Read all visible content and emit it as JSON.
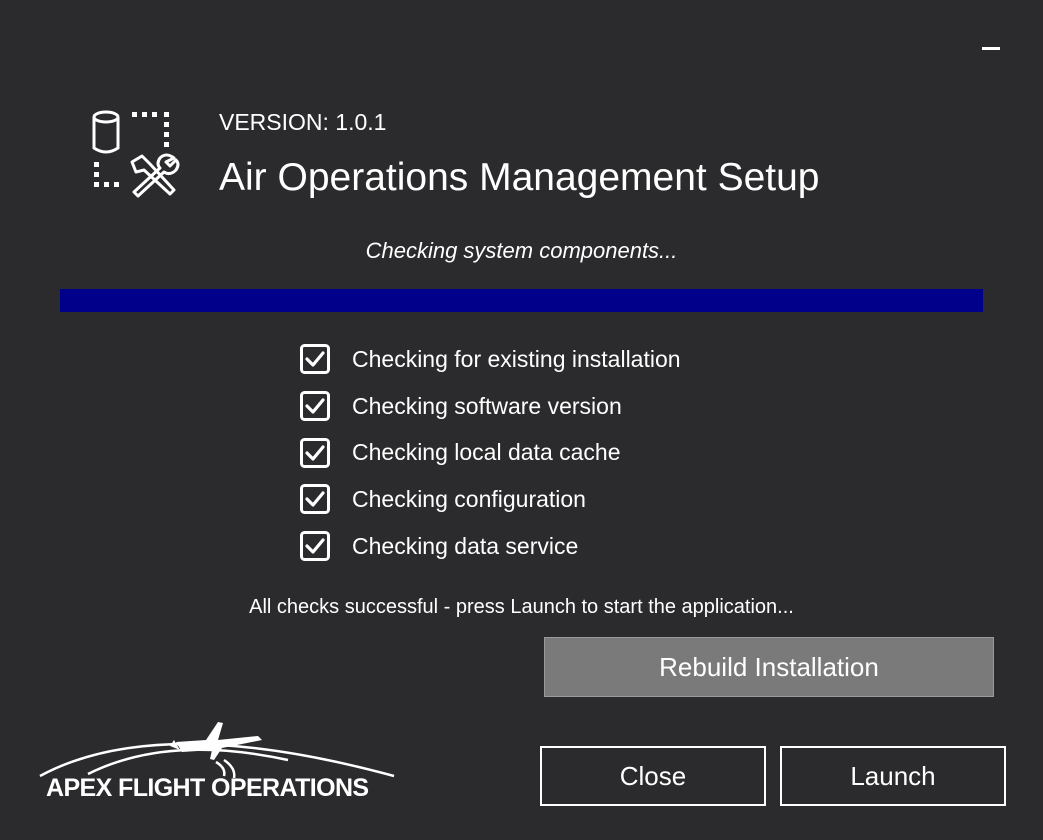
{
  "window": {
    "minimize_icon": "minimize-icon"
  },
  "header": {
    "app_icon": "database-tools-icon",
    "version": "VERSION: 1.0.1",
    "title": "Air Operations Management Setup"
  },
  "progress": {
    "status_text": "Checking system components...",
    "fill_fraction": 1.0,
    "color": "#00008b"
  },
  "checklist": {
    "items": [
      {
        "label": "Checking for existing installation",
        "checked": true
      },
      {
        "label": "Checking software version",
        "checked": true
      },
      {
        "label": "Checking local data cache",
        "checked": true
      },
      {
        "label": "Checking configuration",
        "checked": true
      },
      {
        "label": "Checking data service",
        "checked": true
      }
    ]
  },
  "message": "All checks successful - press Launch to start the application...",
  "buttons": {
    "rebuild": "Rebuild Installation",
    "close": "Close",
    "launch": "Launch"
  },
  "logo": {
    "text": "APEX FLIGHT OPERATIONS",
    "icon": "aircraft-logo-icon"
  },
  "colors": {
    "background": "#2b2b2d",
    "progress_fill": "#00008b",
    "rebuild_button": "#7a7a7a",
    "text": "#ffffff"
  }
}
